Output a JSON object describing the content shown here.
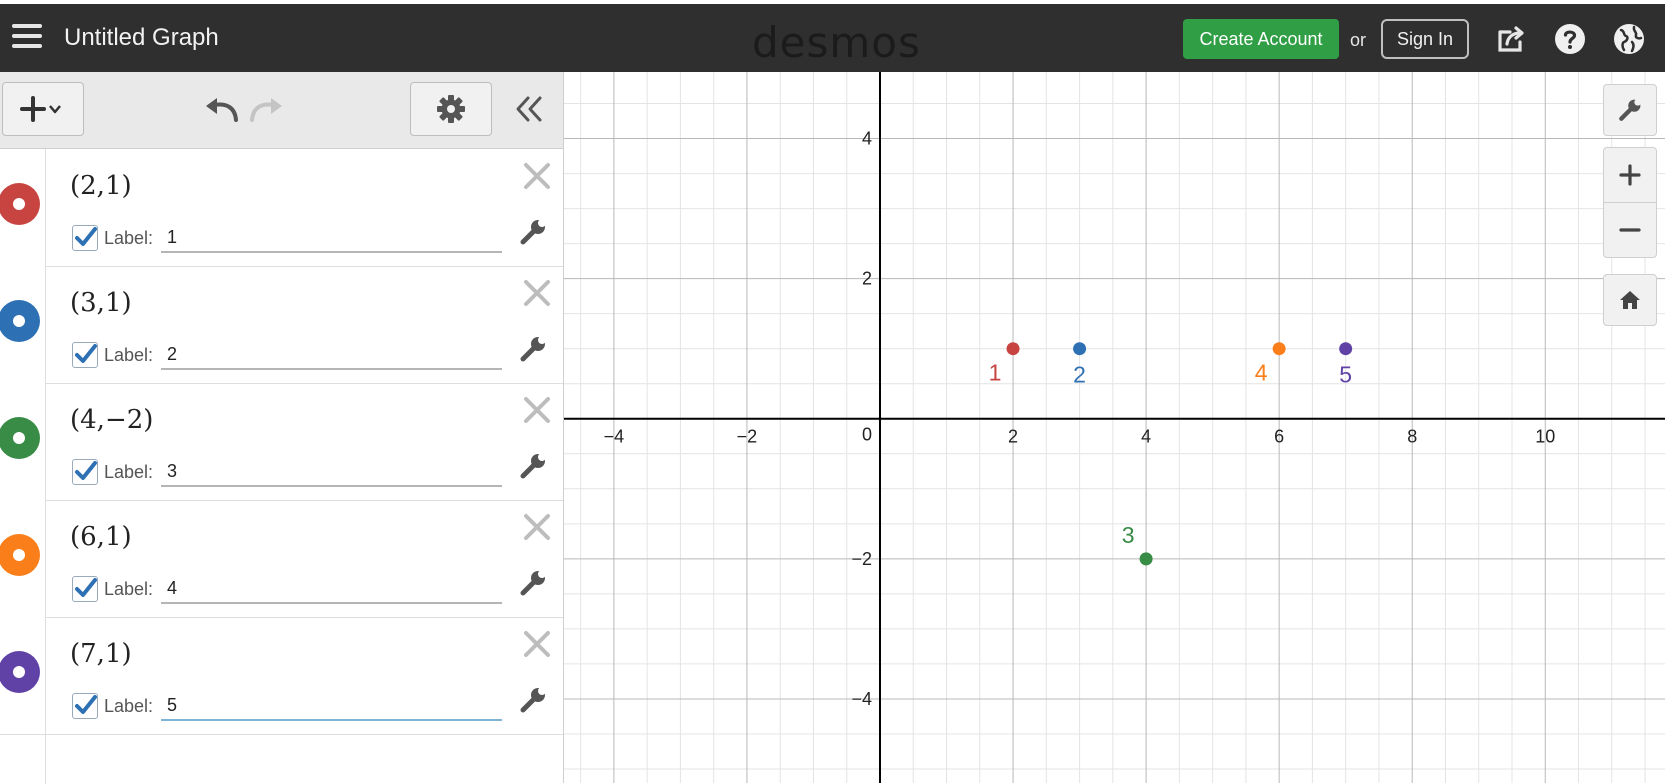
{
  "header": {
    "title": "Untitled Graph",
    "logo": "desmos",
    "create_account": "Create Account",
    "or": "or",
    "sign_in": "Sign In"
  },
  "expressions": [
    {
      "latex": "(2,1)",
      "color": "#c74440",
      "label": "1"
    },
    {
      "latex": "(3,1)",
      "color": "#2d70b3",
      "label": "2"
    },
    {
      "latex": "(4,−2)",
      "color": "#388c46",
      "label": "3"
    },
    {
      "latex": "(6,1)",
      "color": "#fa7e19",
      "label": "4"
    },
    {
      "latex": "(7,1)",
      "color": "#6042a6",
      "label": "5"
    }
  ],
  "label_prefix": "Label:",
  "graph": {
    "xlim": [
      -4.75,
      11.8
    ],
    "ylim": [
      -5.2,
      4.95
    ],
    "x_ticks": [
      -4,
      -2,
      2,
      4,
      6,
      8,
      10
    ],
    "y_ticks": [
      -4,
      -2,
      2,
      4
    ],
    "origin_label": "0",
    "points": [
      {
        "x": 2,
        "y": 1,
        "label": "1",
        "color": "#c74440",
        "label_dir": "below-left"
      },
      {
        "x": 3,
        "y": 1,
        "label": "2",
        "color": "#2d70b3",
        "label_dir": "below"
      },
      {
        "x": 4,
        "y": -2,
        "label": "3",
        "color": "#388c46",
        "label_dir": "above-left"
      },
      {
        "x": 6,
        "y": 1,
        "label": "4",
        "color": "#fa7e19",
        "label_dir": "below-left"
      },
      {
        "x": 7,
        "y": 1,
        "label": "5",
        "color": "#6042a6",
        "label_dir": "below"
      }
    ]
  },
  "icons": {
    "menu": "hamburger-icon",
    "share": "share-icon",
    "help": "help-icon",
    "language": "globe-icon",
    "add": "plus-icon",
    "undo": "undo-icon",
    "redo": "redo-icon",
    "settings": "gear-icon",
    "collapse": "double-chevron-left-icon",
    "wrench": "wrench-icon",
    "zoom_in": "plus-icon",
    "zoom_out": "minus-icon",
    "home": "home-icon"
  }
}
